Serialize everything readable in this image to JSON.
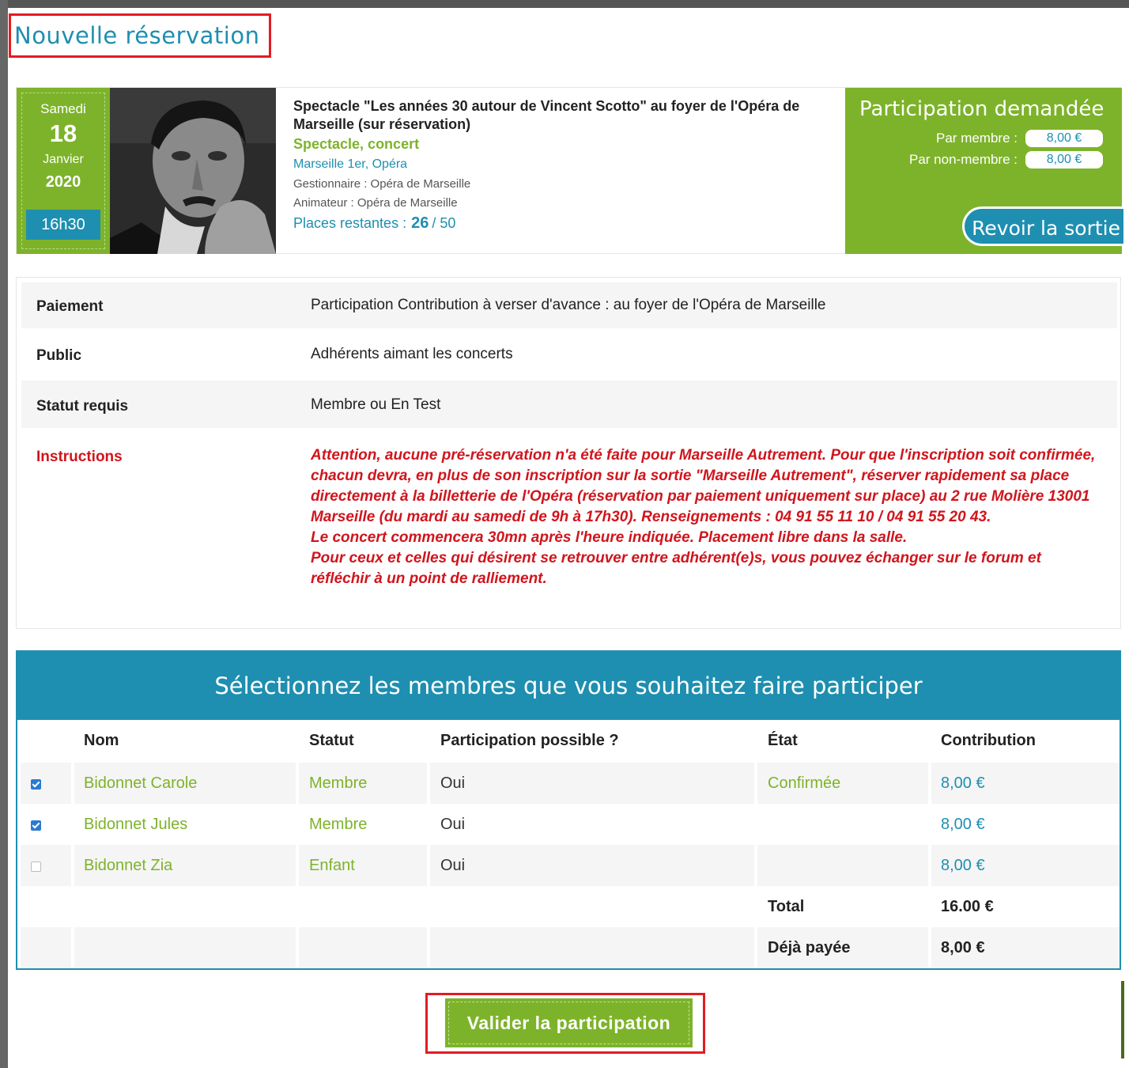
{
  "page": {
    "title": "Nouvelle réservation"
  },
  "event": {
    "date": {
      "day": "Samedi",
      "number": "18",
      "month": "Janvier",
      "year": "2020",
      "time": "16h30"
    },
    "title": "Spectacle \"Les années 30 autour de Vincent Scotto\" au foyer de l'Opéra de Marseille (sur réservation)",
    "category": "Spectacle, concert",
    "location": "Marseille 1er, Opéra",
    "manager": "Gestionnaire : Opéra de Marseille",
    "host": "Animateur : Opéra de Marseille",
    "places": {
      "label": "Places restantes :",
      "remaining": "26",
      "total": "/ 50"
    }
  },
  "participation": {
    "title": "Participation demandée",
    "member_label": "Par membre :",
    "member_price": "8,00 €",
    "non_member_label": "Par non-membre :",
    "non_member_price": "8,00 €",
    "back_button": "Revoir la sortie"
  },
  "info": {
    "payment": {
      "label": "Paiement",
      "value": "Participation Contribution à verser d'avance : au foyer de l'Opéra de Marseille"
    },
    "public": {
      "label": "Public",
      "value": "Adhérents aimant les concerts"
    },
    "status": {
      "label": "Statut requis",
      "value": "Membre ou En Test"
    },
    "instructions": {
      "label": "Instructions",
      "line1": "Attention, aucune pré-réservation n'a été faite pour Marseille Autrement. Pour que l'inscription soit confirmée, chacun devra, en plus de son inscription sur la sortie \"Marseille Autrement\", réserver rapidement sa place directement à la billetterie de l'Opéra (réservation par paiement uniquement sur place) au 2 rue Molière 13001 Marseille (du mardi au samedi de 9h à 17h30). Renseignements : 04 91 55 11 10 / 04 91 55 20 43.",
      "line2": "Le concert commencera 30mn après l'heure indiquée. Placement libre dans la salle.",
      "line3": "Pour ceux et celles qui désirent se retrouver entre adhérent(e)s, vous pouvez échanger sur le forum et réfléchir à un point de ralliement."
    }
  },
  "members": {
    "header": "Sélectionnez les membres que vous souhaitez faire participer",
    "columns": {
      "name": "Nom",
      "status": "Statut",
      "possible": "Participation possible ?",
      "state": "État",
      "contribution": "Contribution"
    },
    "rows": [
      {
        "checked": true,
        "name": "Bidonnet Carole",
        "status": "Membre",
        "possible": "Oui",
        "state": "Confirmée",
        "contribution": "8,00 €"
      },
      {
        "checked": true,
        "name": "Bidonnet Jules",
        "status": "Membre",
        "possible": "Oui",
        "state": "",
        "contribution": "8,00 €"
      },
      {
        "checked": false,
        "name": "Bidonnet Zia",
        "status": "Enfant",
        "possible": "Oui",
        "state": "",
        "contribution": "8,00 €"
      }
    ],
    "total_label": "Total",
    "total_value": "16.00 €",
    "paid_label": "Déjà payée",
    "paid_value": "8,00 €"
  },
  "actions": {
    "validate": "Valider la participation"
  },
  "colors": {
    "green": "#7db32a",
    "blue": "#1e8fb0",
    "red": "#d0151d",
    "highlight": "#e31b23"
  }
}
